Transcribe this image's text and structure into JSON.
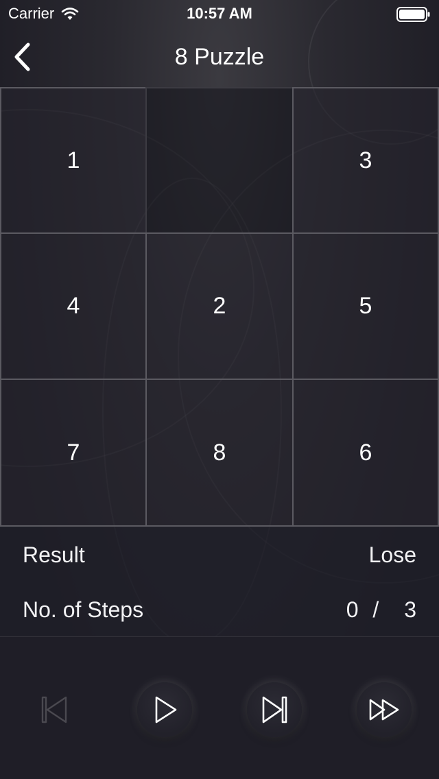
{
  "status_bar": {
    "carrier": "Carrier",
    "time": "10:57 AM"
  },
  "nav": {
    "title": "8 Puzzle"
  },
  "board": {
    "tiles": [
      "1",
      "",
      "3",
      "4",
      "2",
      "5",
      "7",
      "8",
      "6"
    ]
  },
  "info": {
    "result_label": "Result",
    "result_value": "Lose",
    "steps_label": "No. of Steps",
    "steps_current": "0",
    "steps_separator": "/",
    "steps_total": "3"
  },
  "controls": {
    "icons": [
      "rewind-to-start-icon",
      "play-icon",
      "step-forward-icon",
      "fast-forward-icon"
    ],
    "first_enabled": false
  },
  "colors": {
    "background": "#1f1e26",
    "tile_border": "#5b5a61",
    "text": "#ffffff"
  }
}
